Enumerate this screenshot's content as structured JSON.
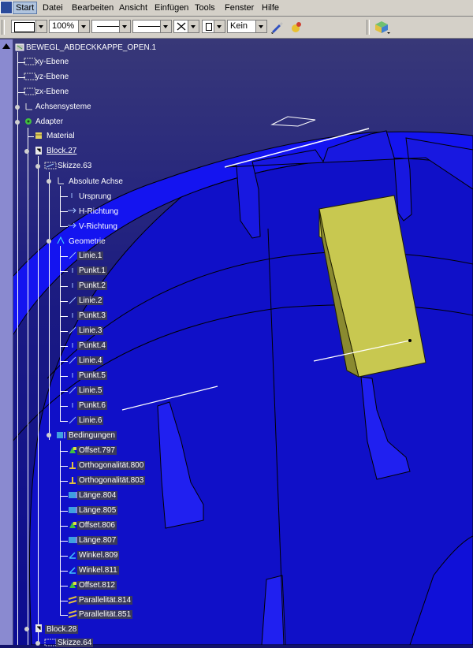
{
  "menubar": {
    "items": [
      "Start",
      "Datei",
      "Bearbeiten",
      "Ansicht",
      "Einfügen",
      "Tools",
      "Fenster",
      "Hilfe"
    ]
  },
  "toolbar": {
    "zoom_value": "100%",
    "linetype_value": "Kein"
  },
  "tree": {
    "root": "BEWEGL_ABDECKKAPPE_OPEN.1",
    "xy": "xy-Ebene",
    "yz": "yz-Ebene",
    "zx": "zx-Ebene",
    "achsensysteme": "Achsensysteme",
    "adapter": "Adapter",
    "material": "Material",
    "block27": "Block.27",
    "skizze63": "Skizze.63",
    "absolute_achse": "Absolute Achse",
    "ursprung": "Ursprung",
    "h_richtung": "H-Richtung",
    "v_richtung": "V-Richtung",
    "geometrie": "Geometrie",
    "geometry_items": [
      "Linie.1",
      "Punkt.1",
      "Punkt.2",
      "Linie.2",
      "Punkt.3",
      "Linie.3",
      "Punkt.4",
      "Linie.4",
      "Punkt.5",
      "Linie.5",
      "Punkt.6",
      "Linie.6"
    ],
    "bedingungen": "Bedingungen",
    "constraint_items": [
      "Offset.797",
      "Orthogonalität.800",
      "Orthogonalität.803",
      "Länge.804",
      "Länge.805",
      "Offset.806",
      "Länge.807",
      "Winkel.809",
      "Winkel.811",
      "Offset.812",
      "Parallelität.814",
      "Parallelität.851"
    ],
    "block28": "Block.28",
    "skizze64": "Skizze.64"
  },
  "colors": {
    "menu_bg": "#d4d0c8",
    "viewport_blue": "#1a1aa8",
    "ring_blue": "#1010e8",
    "pad_yellow": "#c8c850"
  }
}
